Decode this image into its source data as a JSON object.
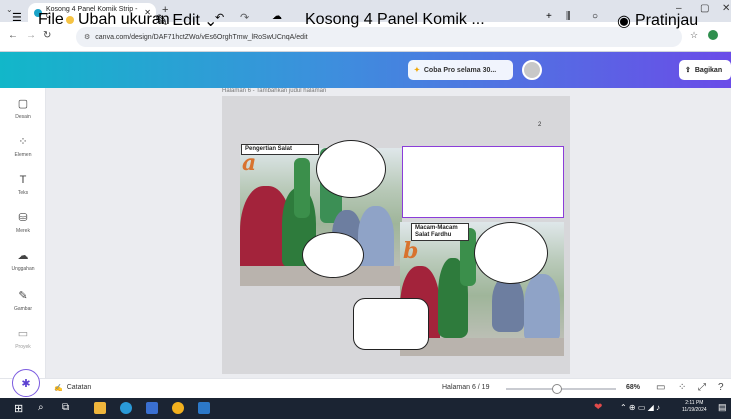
{
  "browser": {
    "tab_title": "Kosong 4 Panel Komik Strip - C",
    "tab_close": "✕",
    "new_tab": "+",
    "url": "canva.com/design/DAF71hctZWo/vEs6OrghTmw_lRoSwUCnqA/edit",
    "win_min": "–",
    "win_max": "▢",
    "win_close": "✕"
  },
  "canva": {
    "menu": "File",
    "resize": "Ubah ukuran",
    "edit": "Edit",
    "doc_title": "Kosong 4 Panel Komik ...",
    "pro": "Coba Pro selama 30...",
    "preview": "Pratinjau",
    "share": "Bagikan"
  },
  "sidebar": {
    "items": [
      {
        "label": "Desain",
        "icon": "▢"
      },
      {
        "label": "Elemen",
        "icon": "⁘"
      },
      {
        "label": "Teks",
        "icon": "T"
      },
      {
        "label": "Merek",
        "icon": "⛁"
      },
      {
        "label": "Unggahan",
        "icon": "☁"
      },
      {
        "label": "Gambar",
        "icon": "✎"
      },
      {
        "label": "Proyek",
        "icon": "▭"
      }
    ]
  },
  "page": {
    "header": "Halaman 6 - Tambahkan judul halaman",
    "number": "2",
    "panel_a_title": "Pengertian Salat",
    "panel_a_letter": "a",
    "panel_b_title_1": "Macam-Macam",
    "panel_b_title_2": "Salat  Fardhu",
    "panel_b_letter": "b"
  },
  "bottom": {
    "notes": "Catatan",
    "page_indicator": "Halaman 6 / 19",
    "zoom": "68%",
    "zoom_fraction": 0.68
  },
  "taskbar": {
    "time": "2:11 PM",
    "date": "11/19/2024"
  }
}
